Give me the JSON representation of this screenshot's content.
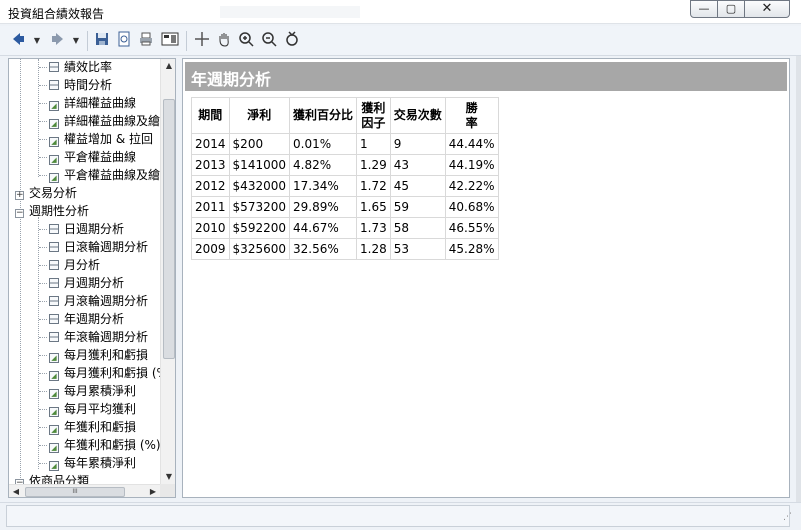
{
  "window": {
    "title": "投資組合績效報告",
    "controls": {
      "minimize": "—",
      "maximize": "▢",
      "close": "✕"
    }
  },
  "toolbar": {
    "icons": [
      "back-icon",
      "forward-icon",
      "save-icon",
      "preview-icon",
      "print-icon",
      "view-icon",
      "crosshair-icon",
      "hand-icon",
      "zoom-in-icon",
      "zoom-out-icon",
      "reset-icon"
    ]
  },
  "tree": {
    "items": [
      {
        "label": "績效比率",
        "icon": "grid",
        "depth": 2
      },
      {
        "label": "時間分析",
        "icon": "grid",
        "depth": 2
      },
      {
        "label": "詳細權益曲線",
        "icon": "chart",
        "depth": 2
      },
      {
        "label": "詳細權益曲線及繪",
        "icon": "chart",
        "depth": 2
      },
      {
        "label": "權益增加 & 拉回",
        "icon": "chart",
        "depth": 2
      },
      {
        "label": "平倉權益曲線",
        "icon": "chart",
        "depth": 2
      },
      {
        "label": "平倉權益曲線及繪",
        "icon": "chart",
        "depth": 2
      },
      {
        "label": "交易分析",
        "icon": "expand",
        "depth": 1,
        "expander": "+"
      },
      {
        "label": "週期性分析",
        "icon": "expand",
        "depth": 1,
        "expander": "−"
      },
      {
        "label": "日週期分析",
        "icon": "grid",
        "depth": 2
      },
      {
        "label": "日滾輪週期分析",
        "icon": "grid",
        "depth": 2
      },
      {
        "label": "月分析",
        "icon": "grid",
        "depth": 2
      },
      {
        "label": "月週期分析",
        "icon": "grid",
        "depth": 2
      },
      {
        "label": "月滾輪週期分析",
        "icon": "grid",
        "depth": 2
      },
      {
        "label": "年週期分析",
        "icon": "grid",
        "depth": 2
      },
      {
        "label": "年滾輪週期分析",
        "icon": "grid",
        "depth": 2
      },
      {
        "label": "每月獲利和虧損",
        "icon": "chart",
        "depth": 2
      },
      {
        "label": "每月獲利和虧損 (%",
        "icon": "chart",
        "depth": 2
      },
      {
        "label": "每月累積淨利",
        "icon": "chart",
        "depth": 2
      },
      {
        "label": "每月平均獲利",
        "icon": "chart",
        "depth": 2
      },
      {
        "label": "年獲利和虧損",
        "icon": "chart",
        "depth": 2
      },
      {
        "label": "年獲利和虧損 (%)",
        "icon": "chart",
        "depth": 2
      },
      {
        "label": "每年累積淨利",
        "icon": "chart",
        "depth": 2
      },
      {
        "label": "依商品分類",
        "icon": "expand",
        "depth": 1,
        "expander": "−"
      }
    ],
    "hscroll_thumb": "III"
  },
  "report": {
    "title": "年週期分析",
    "columns": [
      "期間",
      "淨利",
      "獲利百分比",
      "獲利\n因子",
      "交易次數",
      "勝\n率"
    ],
    "rows": [
      [
        "2014",
        "$200",
        "0.01%",
        "1",
        "9",
        "44.44%"
      ],
      [
        "2013",
        "$141000",
        "4.82%",
        "1.29",
        "43",
        "44.19%"
      ],
      [
        "2012",
        "$432000",
        "17.34%",
        "1.72",
        "45",
        "42.22%"
      ],
      [
        "2011",
        "$573200",
        "29.89%",
        "1.65",
        "59",
        "40.68%"
      ],
      [
        "2010",
        "$592200",
        "44.67%",
        "1.73",
        "58",
        "46.55%"
      ],
      [
        "2009",
        "$325600",
        "32.56%",
        "1.28",
        "53",
        "45.28%"
      ]
    ]
  }
}
